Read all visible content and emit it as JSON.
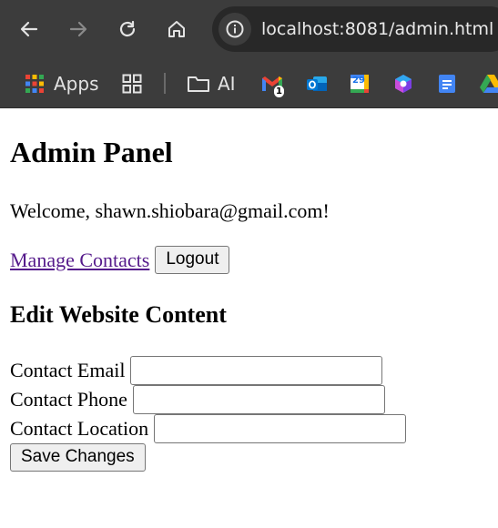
{
  "browser": {
    "url": "localhost:8081/admin.html",
    "bookmarks": {
      "apps_label": "Apps",
      "ai_label": "AI",
      "gmail_badge": "1",
      "calendar_day": "29"
    }
  },
  "page": {
    "title": "Admin Panel",
    "welcome": "Welcome, shawn.shiobara@gmail.com!",
    "manage_contacts_link": "Manage Contacts",
    "logout_label": "Logout",
    "section_title": "Edit Website Content",
    "fields": [
      {
        "label": "Contact Email",
        "value": ""
      },
      {
        "label": "Contact Phone",
        "value": ""
      },
      {
        "label": "Contact Location",
        "value": ""
      }
    ],
    "save_label": "Save Changes"
  },
  "colors": {
    "chrome_bg": "#3c3c3c",
    "omnibox_bg": "#282828",
    "visited_link": "#551a8b"
  }
}
